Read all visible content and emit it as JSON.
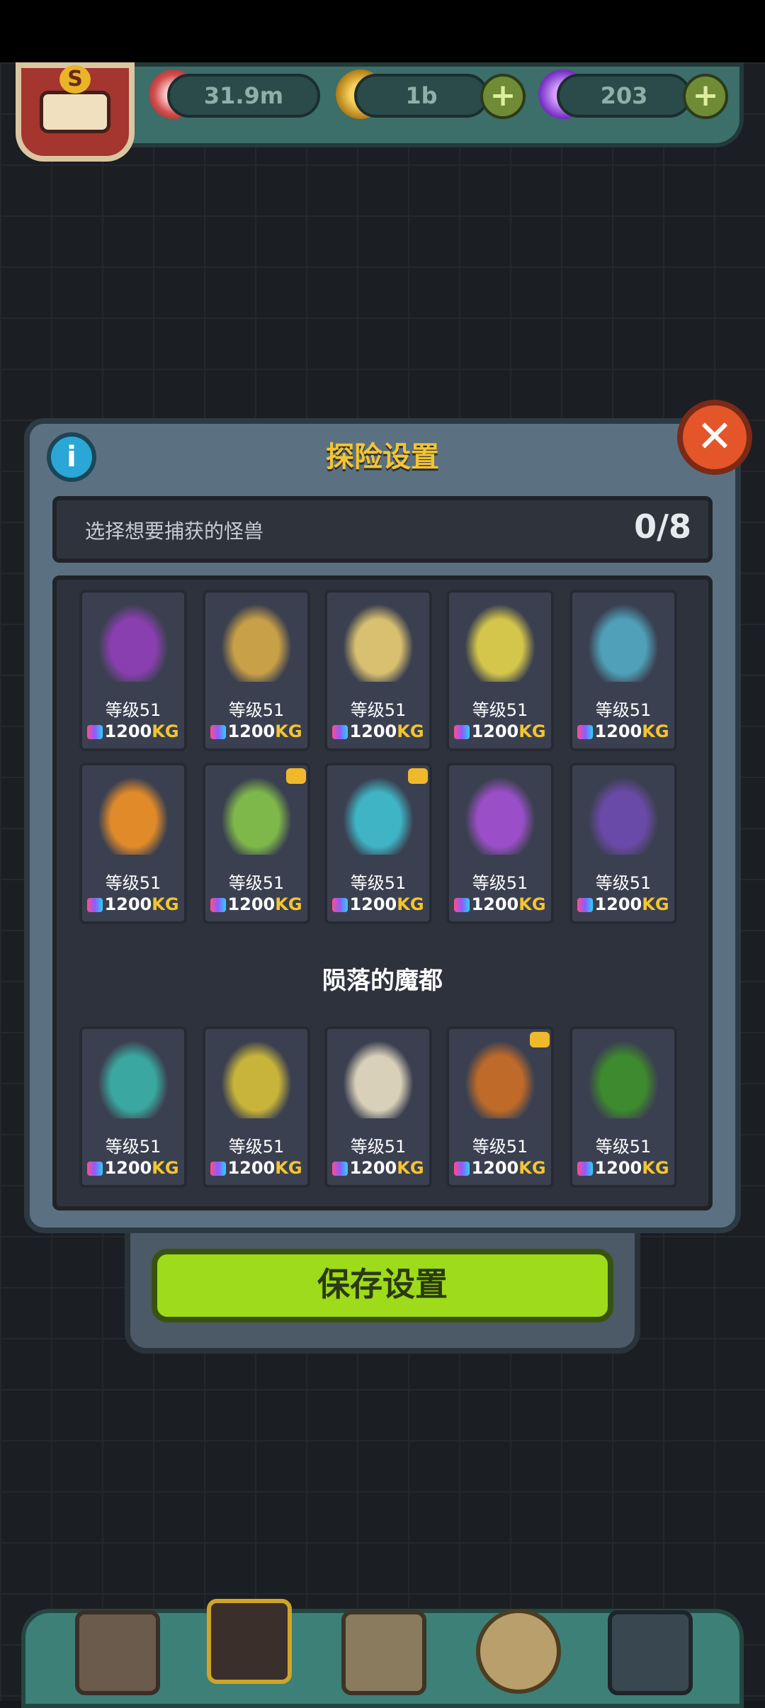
{
  "resources": [
    {
      "icon": "eyeball-icon",
      "value": "31.9m"
    },
    {
      "icon": "gold-coin-icon",
      "value": "1b"
    },
    {
      "icon": "potion-icon",
      "value": "203"
    }
  ],
  "avatar": {
    "badge": "S",
    "icon": "monster-avatar-icon"
  },
  "modal": {
    "title": "探险设置",
    "prompt": "选择想要捕获的怪兽",
    "count": "0/8",
    "section_title": "陨落的魔都",
    "save_label": "保存设置"
  },
  "monsters": [
    {
      "name": "eggplant-monster",
      "level": "等级51",
      "weight_num": "1200",
      "weight_unit": "KG",
      "crown": false
    },
    {
      "name": "rainbow-plant-monster",
      "level": "等级51",
      "weight_num": "1200",
      "weight_unit": "KG",
      "crown": false
    },
    {
      "name": "straw-monster",
      "level": "等级51",
      "weight_num": "1200",
      "weight_unit": "KG",
      "crown": false
    },
    {
      "name": "fan-monster",
      "level": "等级51",
      "weight_num": "1200",
      "weight_unit": "KG",
      "crown": false
    },
    {
      "name": "chameleon-monster",
      "level": "等级51",
      "weight_num": "1200",
      "weight_unit": "KG",
      "crown": false
    },
    {
      "name": "avocado-monster",
      "level": "等级51",
      "weight_num": "1200",
      "weight_unit": "KG",
      "crown": false
    },
    {
      "name": "grass-monster",
      "level": "等级51",
      "weight_num": "1200",
      "weight_unit": "KG",
      "crown": true
    },
    {
      "name": "jellyfish-bubble-monster",
      "level": "等级51",
      "weight_num": "1200",
      "weight_unit": "KG",
      "crown": true
    },
    {
      "name": "purple-jellyfish-monster",
      "level": "等级51",
      "weight_num": "1200",
      "weight_unit": "KG",
      "crown": false
    },
    {
      "name": "grape-angel-monster",
      "level": "等级51",
      "weight_num": "1200",
      "weight_unit": "KG",
      "crown": false
    },
    {
      "name": "frog-monster",
      "level": "等级51",
      "weight_num": "1200",
      "weight_unit": "KG",
      "crown": false
    },
    {
      "name": "hedgehog-monster",
      "level": "等级51",
      "weight_num": "1200",
      "weight_unit": "KG",
      "crown": false
    },
    {
      "name": "alpaca-monster",
      "level": "等级51",
      "weight_num": "1200",
      "weight_unit": "KG",
      "crown": false
    },
    {
      "name": "shell-monster",
      "level": "等级51",
      "weight_num": "1200",
      "weight_unit": "KG",
      "crown": true
    },
    {
      "name": "crocodile-monster",
      "level": "等级51",
      "weight_num": "1200",
      "weight_unit": "KG",
      "crown": false
    }
  ],
  "colors": {
    "accent_yellow": "#f4c531",
    "save_green": "#9edb1a",
    "close_orange": "#e4552a",
    "info_blue": "#2aa7d6"
  },
  "bottom_nav": [
    "shop-icon",
    "dungeon-icon",
    "book-icon",
    "coin-bag-icon",
    "grid-icon"
  ]
}
